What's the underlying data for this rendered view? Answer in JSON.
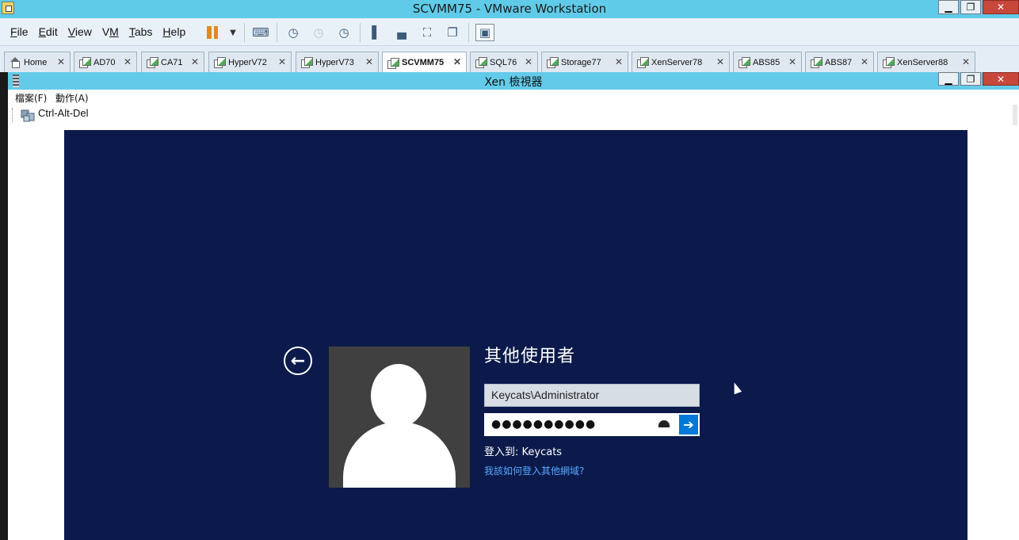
{
  "window": {
    "title": "SCVMM75 - VMware Workstation",
    "buttons": [
      "minimize",
      "restore",
      "close"
    ]
  },
  "menubar": {
    "items": [
      {
        "label": "File",
        "hotkey": "F"
      },
      {
        "label": "Edit",
        "hotkey": "E"
      },
      {
        "label": "View",
        "hotkey": "V"
      },
      {
        "label": "VM",
        "hotkey": "M"
      },
      {
        "label": "Tabs",
        "hotkey": "T"
      },
      {
        "label": "Help",
        "hotkey": "H"
      }
    ],
    "toolbar_icons": [
      "pause-icon",
      "dropdown-arrow-icon",
      "send-ctrl-alt-del-icon",
      "snapshot-take-icon",
      "snapshot-revert-icon",
      "snapshot-manager-icon",
      "show-library-icon",
      "show-thumbnail-icon",
      "full-screen-icon",
      "unity-icon",
      "console-view-icon"
    ],
    "accent_pause": "#e08a1e"
  },
  "tabs": [
    {
      "label": "Home",
      "icon": "home-icon",
      "active": false
    },
    {
      "label": "AD70",
      "icon": "vm-icon",
      "active": false
    },
    {
      "label": "CA71",
      "icon": "vm-icon",
      "active": false
    },
    {
      "label": "HyperV72",
      "icon": "vm-icon",
      "active": false
    },
    {
      "label": "HyperV73",
      "icon": "vm-icon",
      "active": false
    },
    {
      "label": "SCVMM75",
      "icon": "vm-icon",
      "active": true
    },
    {
      "label": "SQL76",
      "icon": "vm-icon",
      "active": false
    },
    {
      "label": "Storage77",
      "icon": "vm-icon",
      "active": false
    },
    {
      "label": "XenServer78",
      "icon": "vm-icon",
      "active": false
    },
    {
      "label": "ABS85",
      "icon": "vm-icon",
      "active": false
    },
    {
      "label": "ABS87",
      "icon": "vm-icon",
      "active": false
    },
    {
      "label": "XenServer88",
      "icon": "vm-icon",
      "active": false
    }
  ],
  "xen_viewer": {
    "title": "Xen 檢視器",
    "menu": {
      "file": "檔案(F)",
      "action": "動作(A)"
    },
    "toolbar": {
      "ctrl_alt_del": "Ctrl-Alt-Del"
    }
  },
  "login": {
    "title": "其他使用者",
    "username": "Keycats\\Administrator",
    "password_mask": "●●●●●●●●●●",
    "sign_in_to": "登入到: Keycats",
    "other_domain_link": "我該如何登入其他網域?",
    "background_color": "#0b1a4b",
    "submit_color": "#0078d7",
    "link_color": "#5aa8ff"
  }
}
